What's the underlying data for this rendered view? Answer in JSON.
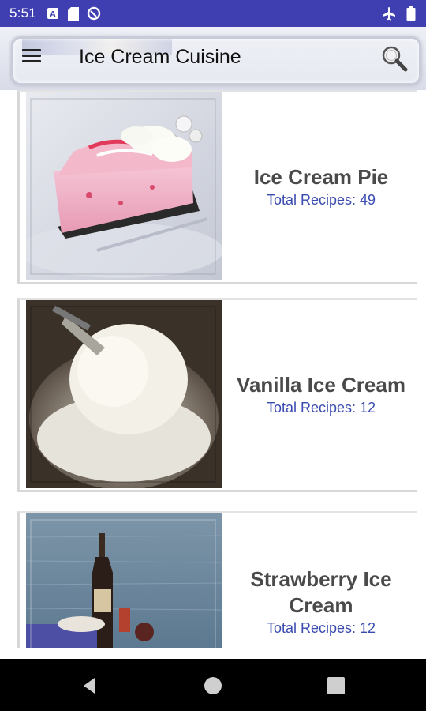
{
  "status_bar": {
    "time": "5:51",
    "left_icons": [
      "font-a-icon",
      "sd-card-icon",
      "data-saver-icon"
    ],
    "right_icons": [
      "airplane-mode-icon",
      "battery-icon"
    ]
  },
  "header": {
    "title": "Ice Cream Cuisine",
    "menu_icon": "hamburger-menu-icon",
    "search_icon": "search-icon"
  },
  "categories": [
    {
      "title": "Ice Cream Pie",
      "count_label": "Total Recipes: 49",
      "image": "pink peppermint ice cream pie slice"
    },
    {
      "title": "Vanilla Ice Cream",
      "count_label": "Total Recipes: 12",
      "image": "vanilla ice cream scoop in bowl"
    },
    {
      "title": "Strawberry Ice Cream",
      "count_label": "Total Recipes: 12",
      "image": "bottle by the sea"
    }
  ],
  "colors": {
    "status_bar": "#3f3fb2",
    "title_text": "#4a4a4a",
    "count_text": "#3a4bb0",
    "nav_bar": "#000000"
  },
  "nav_bar": {
    "buttons": [
      "back-icon",
      "home-icon",
      "recents-icon"
    ]
  }
}
